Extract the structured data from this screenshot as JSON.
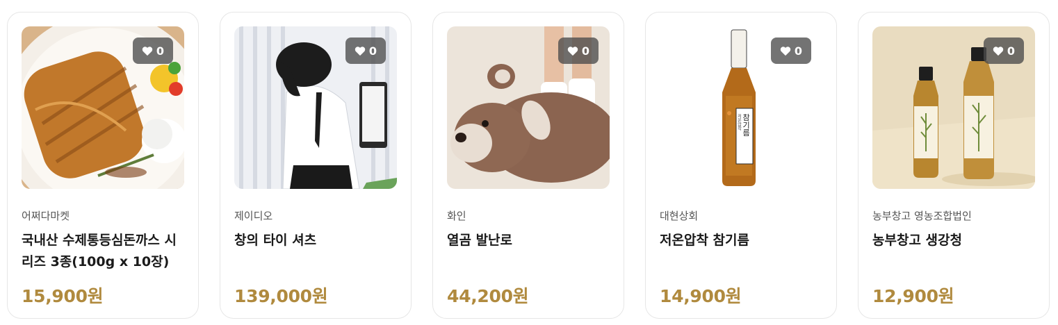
{
  "theme": {
    "price_color": "#b08a3e",
    "like_bg": "#4b4b4b"
  },
  "products": [
    {
      "seller": "어쩌다마켓",
      "name": "국내산 수제통등심돈까스 시리즈 3종(100g x 10장)",
      "price": "15,900원",
      "likes": "0",
      "image": "pork-cutlet-plate-photo"
    },
    {
      "seller": "제이디오",
      "name": "창의 타이 셔츠",
      "price": "139,000원",
      "likes": "0",
      "image": "model-in-white-shirt-tie-photo"
    },
    {
      "seller": "화인",
      "name": "열곰 발난로",
      "price": "44,200원",
      "likes": "0",
      "image": "bear-foot-warmer-photo"
    },
    {
      "seller": "대현상회",
      "name": "저온압착 참기름",
      "price": "14,900원",
      "likes": "0",
      "image": "sesame-oil-bottle-photo",
      "image_label": "참기름",
      "image_sublabel": "저온압착"
    },
    {
      "seller": "농부창고 영농조합법인",
      "name": "농부창고 생강청",
      "price": "12,900원",
      "likes": "0",
      "image": "ginger-syrup-bottles-photo"
    }
  ]
}
